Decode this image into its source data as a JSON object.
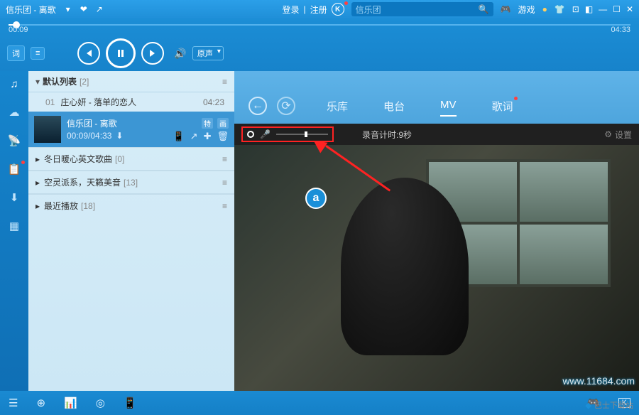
{
  "titlebar": {
    "now_playing": "信乐团 - 离歌",
    "login": "登录",
    "register": "注册",
    "search_value": "信乐团",
    "games_label": "游戏"
  },
  "seek": {
    "current": "00:09",
    "total": "04:33"
  },
  "controls": {
    "lyric_btn": "词",
    "eq_btn": "≡",
    "sound_mode": "原声"
  },
  "playlist": {
    "header": "默认列表",
    "header_count": "[2]",
    "track1_idx": "01",
    "track1_title": "庄心妍 - 落单的恋人",
    "track1_dur": "04:23",
    "active_title": "信乐团 - 离歌",
    "active_time": "00:09/04:33",
    "active_tag1": "特",
    "active_tag2": "画",
    "cat1": "冬日暖心英文歌曲",
    "cat1_count": "[0]",
    "cat2": "空灵派系，天籁美音",
    "cat2_count": "[13]",
    "cat3": "最近播放",
    "cat3_count": "[18]"
  },
  "nav": {
    "tab1": "乐库",
    "tab2": "电台",
    "tab3": "MV",
    "tab4": "歌词"
  },
  "rec": {
    "timer_label": "录音计时:",
    "timer_val": "9秒",
    "settings": "设置"
  },
  "video": {
    "logo": "a"
  },
  "watermark": "www.11684.com",
  "footer": {
    "brand": "巴士下载站"
  }
}
